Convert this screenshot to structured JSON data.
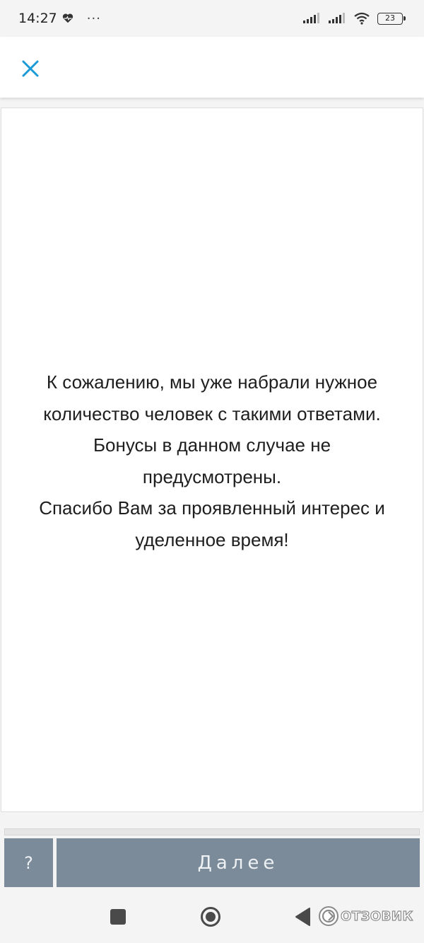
{
  "status_bar": {
    "time": "14:27",
    "icons": [
      "heart-monitor-icon",
      "more-dots-icon",
      "signal-icon",
      "signal-icon",
      "wifi-icon",
      "battery-icon"
    ],
    "dots": "···",
    "battery_level": "23"
  },
  "top_bar": {
    "close_icon": "close-icon",
    "accent_color": "#1a9bd7"
  },
  "message": {
    "lines": [
      "К сожалению, мы уже набрали нужное",
      "количество человек с такими ответами.",
      "Бонусы в данном случае не",
      "предусмотрены.",
      "Спасибо Вам за проявленный интерес и",
      "уделенное время!"
    ]
  },
  "footer": {
    "help_label": "?",
    "next_label": "Далее",
    "button_color": "#7b8b99"
  },
  "nav": {
    "icons": [
      "recents-square-icon",
      "home-circle-icon",
      "back-triangle-icon"
    ],
    "watermark_text": "ОТЗОВИК"
  }
}
